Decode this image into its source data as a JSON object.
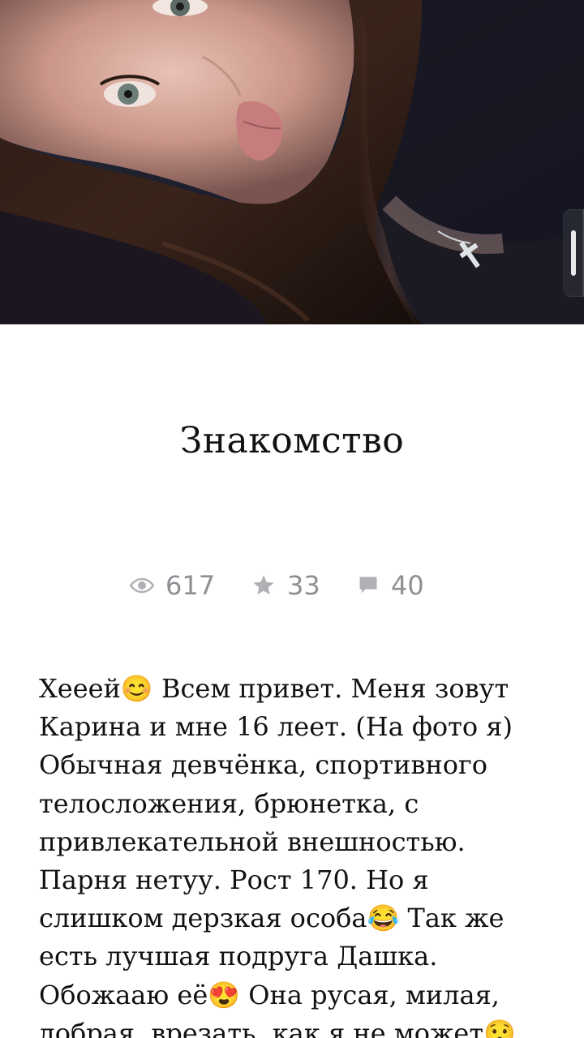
{
  "post": {
    "title": "Знакомство",
    "stats": {
      "views": "617",
      "stars": "33",
      "comments": "40"
    },
    "body_lines": [
      "Хееей😊 Всем привет. Меня зовут",
      "Карина и мне 16 леет. (На фото я)",
      "Обычная девчёнка, спортивного",
      "телосложения, брюнетка, с",
      "привлекательной внешностью.",
      "Парня нетуу. Рост 170. Но я",
      "слишком дерзкая особа😂 Так же",
      "есть лучшая подруга Дашка.",
      "Обожааю её😍 Она русая, милая,",
      "добрая, врезать, как я не может😯"
    ]
  },
  "icons": {
    "views": "eye-icon",
    "stars": "star-icon",
    "comments": "comment-icon"
  },
  "colors": {
    "stat_gray": "#8e8e93",
    "text": "#111111",
    "background": "#ffffff"
  }
}
